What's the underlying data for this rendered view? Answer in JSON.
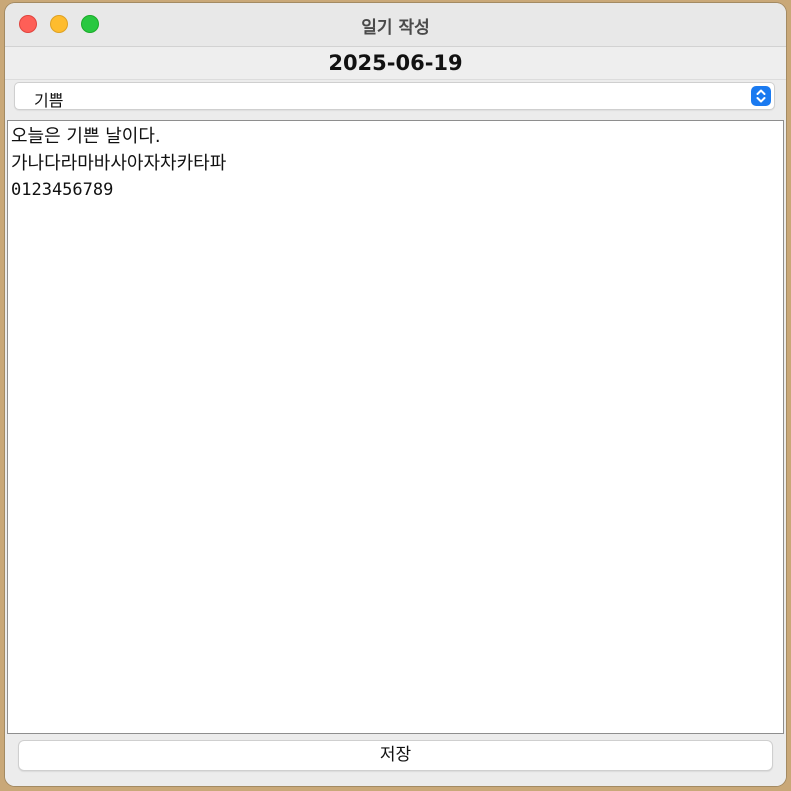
{
  "window": {
    "title": "일기 작성"
  },
  "header": {
    "date": "2025-06-19"
  },
  "mood_select": {
    "selected": "기쁨"
  },
  "editor": {
    "lines": [
      "오늘은 기쁜 날이다.",
      "가나다라마바사아자차카타파",
      "0123456789"
    ]
  },
  "actions": {
    "save_label": "저장"
  },
  "colors": {
    "close": "#fe5f57",
    "minimize": "#febc2e",
    "zoom": "#28c840",
    "accent": "#1a7af0"
  },
  "icons": {
    "select_arrows": "chevron-up-down-icon"
  }
}
